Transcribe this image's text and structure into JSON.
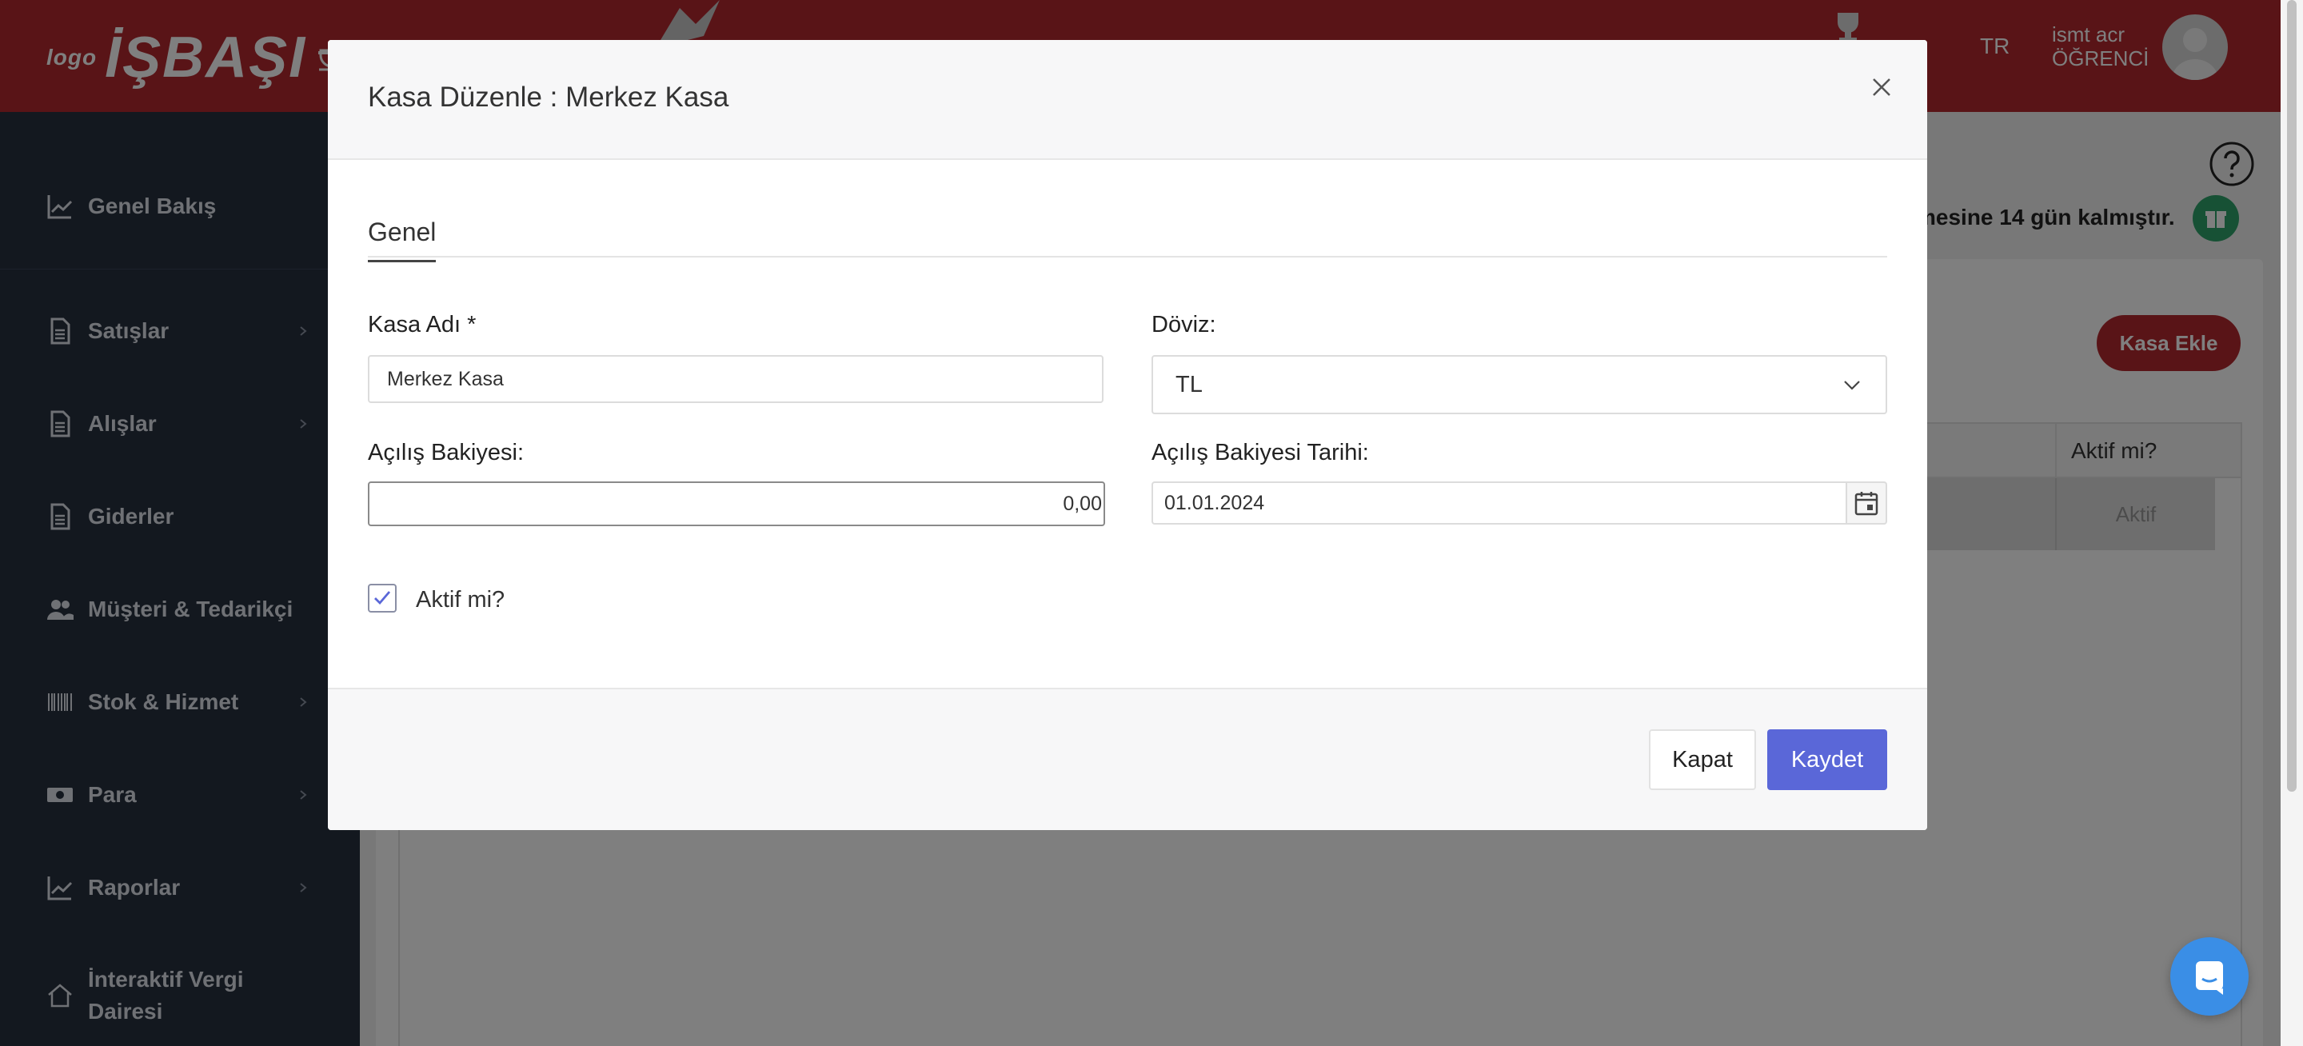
{
  "header": {
    "logo_small": "logo",
    "logo_main": "İŞBAŞI",
    "trophy_sub": "!",
    "lang": "TR",
    "user_name": "ismt acr",
    "user_role": "ÖĞRENCİ"
  },
  "sidebar": {
    "items": [
      {
        "label": "Genel Bakış",
        "icon": "chart-line-icon",
        "has_children": false
      },
      {
        "label": "Satışlar",
        "icon": "document-icon",
        "has_children": true
      },
      {
        "label": "Alışlar",
        "icon": "document-icon",
        "has_children": true
      },
      {
        "label": "Giderler",
        "icon": "document-icon",
        "has_children": false
      },
      {
        "label": "Müşteri & Tedarikçi",
        "icon": "users-icon",
        "has_children": false
      },
      {
        "label": "Stok & Hizmet",
        "icon": "barcode-icon",
        "has_children": true
      },
      {
        "label": "Para",
        "icon": "money-icon",
        "has_children": true
      },
      {
        "label": "Raporlar",
        "icon": "chart-line-icon",
        "has_children": true
      },
      {
        "label": "İnteraktif Vergi Dairesi",
        "icon": "home-icon",
        "has_children": false
      }
    ]
  },
  "main": {
    "trial_text": "mesine 14 gün kalmıştır.",
    "add_button": "Kasa Ekle",
    "table": {
      "columns": [
        "Aktif mi?"
      ],
      "rows": [
        {
          "aktif": "Aktif"
        }
      ]
    }
  },
  "modal": {
    "title": "Kasa Düzenle : Merkez Kasa",
    "tab": "Genel",
    "kasa_adi_label": "Kasa Adı *",
    "kasa_adi_value": "Merkez Kasa",
    "doviz_label": "Döviz:",
    "doviz_value": "TL",
    "bakiye_label": "Açılış Bakiyesi:",
    "bakiye_value": "0,00",
    "tarih_label": "Açılış Bakiyesi Tarihi:",
    "tarih_value": "01.01.2024",
    "aktif_label": "Aktif mi?",
    "aktif_checked": true,
    "kapat_button": "Kapat",
    "kaydet_button": "Kaydet"
  },
  "colors": {
    "brand_red": "#b3292e",
    "sidebar_bg": "#27303f",
    "primary_button": "#5a67d8",
    "chat_button": "#3a8ee6",
    "gift_green": "#2fa36b"
  }
}
